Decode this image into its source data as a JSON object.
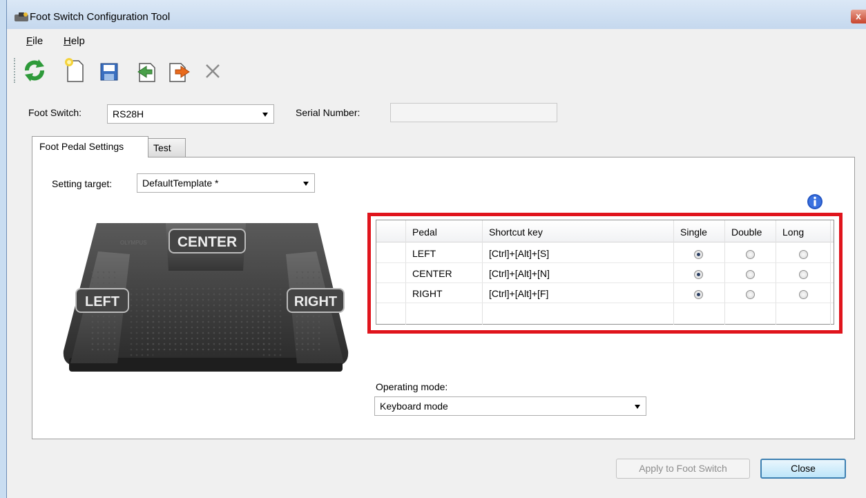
{
  "window": {
    "title": "Foot Switch Configuration Tool",
    "close_glyph": "x"
  },
  "menu": [
    {
      "label": "File",
      "accel": "F"
    },
    {
      "label": "Help",
      "accel": "H"
    }
  ],
  "toolbar": [
    {
      "name": "refresh-icon",
      "color": "#2e9a3a"
    },
    {
      "name": "new-file-icon",
      "color": "#f5d33a"
    },
    {
      "name": "save-icon",
      "color": "#3a6fc0"
    },
    {
      "name": "import-icon",
      "color": "#4aa04a"
    },
    {
      "name": "export-icon",
      "color": "#e86a1c"
    },
    {
      "name": "delete-icon",
      "color": "#8a8a8a"
    }
  ],
  "foot_switch": {
    "label": "Foot Switch:",
    "value": "RS28H"
  },
  "serial_number": {
    "label": "Serial Number:",
    "value": ""
  },
  "tabs": [
    {
      "label": "Foot Pedal Settings",
      "active": true
    },
    {
      "label": "Test",
      "active": false
    }
  ],
  "setting_target": {
    "label": "Setting target:",
    "value": "DefaultTemplate *"
  },
  "pedal_image": {
    "center_label": "CENTER",
    "left_label": "LEFT",
    "right_label": "RIGHT",
    "brand_label": "OLYMPUS"
  },
  "pedal_table": {
    "columns": [
      "Pedal",
      "Shortcut key",
      "Single",
      "Double",
      "Long"
    ],
    "rows": [
      {
        "pedal": "LEFT",
        "shortcut": "[Ctrl]+[Alt]+[S]",
        "selected": "Single"
      },
      {
        "pedal": "CENTER",
        "shortcut": "[Ctrl]+[Alt]+[N]",
        "selected": "Single"
      },
      {
        "pedal": "RIGHT",
        "shortcut": "[Ctrl]+[Alt]+[F]",
        "selected": "Single"
      }
    ],
    "highlight_color": "#e0141c"
  },
  "operating_mode": {
    "label": "Operating mode:",
    "value": "Keyboard mode"
  },
  "buttons": {
    "apply": "Apply to Foot Switch",
    "close": "Close"
  }
}
